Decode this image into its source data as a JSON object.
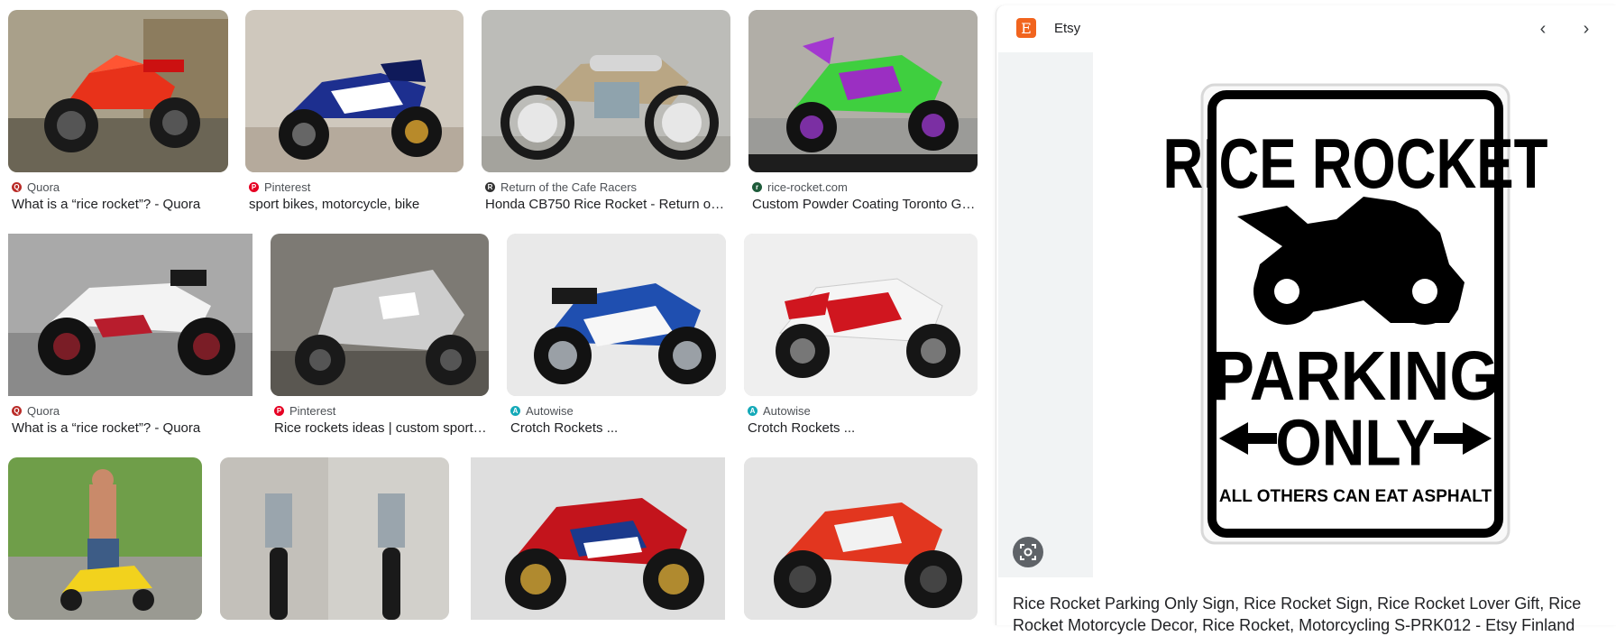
{
  "results": [
    {
      "source": "Quora",
      "favicon_color": "#b92b27",
      "favicon_glyph": "Q",
      "title": "What is a “rice rocket”? - Quora",
      "image": "red-sport-bike-photo"
    },
    {
      "source": "Pinterest",
      "favicon_color": "#e60023",
      "favicon_glyph": "P",
      "title": "sport bikes, motorcycle, bike",
      "image": "blue-suzuki-sport-bike-photo"
    },
    {
      "source": "Return of the Cafe Racers",
      "favicon_color": "#333333",
      "favicon_glyph": "R",
      "title": "Honda CB750 Rice Rocket - Return of ...",
      "image": "cafe-racer-photo"
    },
    {
      "source": "rice-rocket.com",
      "favicon_color": "#1e5b3a",
      "favicon_glyph": "r",
      "title": "Custom Powder Coating Toronto GTA",
      "image": "green-purple-stunt-bike-photo"
    },
    {
      "source": "Quora",
      "favicon_color": "#b92b27",
      "favicon_glyph": "Q",
      "title": "What is a “rice rocket”? - Quora",
      "image": "white-sport-bike-photo"
    },
    {
      "source": "Pinterest",
      "favicon_color": "#e60023",
      "favicon_glyph": "P",
      "title": "Rice rockets ideas | custom sport ...",
      "image": "silver-custom-bike-photo"
    },
    {
      "source": "Autowise",
      "favicon_color": "#14a9b8",
      "favicon_glyph": "A",
      "title": "Crotch Rockets ...",
      "image": "blue-white-suzuki-photo"
    },
    {
      "source": "Autowise",
      "favicon_color": "#14a9b8",
      "favicon_glyph": "A",
      "title": "Crotch Rockets ...",
      "image": "red-white-yamaha-photo"
    },
    {
      "image": "man-with-yellow-minibike-photo"
    },
    {
      "image": "vintage-bike-front-rear-photo"
    },
    {
      "image": "honda-fireblade-photo"
    },
    {
      "image": "red-ducati-photo"
    }
  ],
  "panel": {
    "site_name": "Etsy",
    "logo_letter": "E",
    "prev_label": "‹",
    "next_label": "›",
    "sign": {
      "line1": "RICE ROCKET",
      "line2": "PARKING",
      "line3": "ONLY",
      "line4": "ALL OTHERS CAN EAT ASPHALT"
    },
    "caption": "Rice Rocket Parking Only Sign, Rice Rocket Sign, Rice Rocket Lover Gift, Rice Rocket Motorcycle Decor, Rice Rocket, Motorcycling S-PRK012 - Etsy Finland"
  },
  "colors": {
    "accent_etsy": "#f1641e",
    "text_secondary": "#4d5156",
    "panel_bg": "#f1f3f4"
  }
}
